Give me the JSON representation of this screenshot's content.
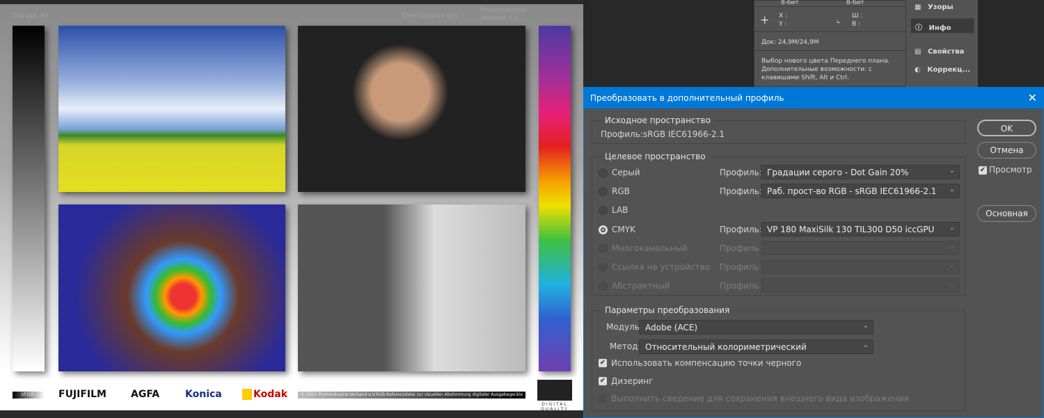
{
  "document": {
    "resolution_label": "300 ppi, A4",
    "initiative": "Eine Initiative des",
    "org_line1": "Photoindustrie-",
    "org_line2": "Verband e.V.",
    "srgb_badge": "sRGB",
    "logos": [
      "FUJIFILM",
      "AGFA",
      "Konica",
      "Kodak"
    ],
    "copyright": "© 2001 Photoindustrie-Verband e.V.",
    "ref_caption": "RGB-Referenzdatei zur visuellen Abstimmung digitaler Ausgabegeräte",
    "dq_logo": "DIGITAL QUALITY"
  },
  "info_panel": {
    "bit_left": "8-бит",
    "bit_right": "8-бит",
    "x_label": "X :",
    "y_label": "Y :",
    "w_label": "Ш :",
    "h_label": "В :",
    "doc": "Док: 24,9M/24,9M",
    "hint": "Выбор нового цвета Переднего плана. Дополнительные возможности: с клавишами Shift, Alt и Ctrl."
  },
  "side_panels": [
    {
      "label": "Узоры",
      "icon": "patterns-icon"
    },
    {
      "label": "Инфо",
      "icon": "info-icon",
      "active": true
    },
    {
      "label": "Свойства",
      "icon": "properties-icon"
    },
    {
      "label": "Коррекц...",
      "icon": "adjustments-icon"
    }
  ],
  "dialog": {
    "title": "Преобразовать в дополнительный профиль",
    "source": {
      "legend": "Исходное пространство",
      "profile_label": "Профиль:",
      "profile": "sRGB IEC61966-2.1"
    },
    "target": {
      "legend": "Целевое пространство",
      "profile_label": "Профиль:",
      "options": [
        {
          "label": "Серый",
          "value": "Градации серого - Dot Gain 20%",
          "enabled": true,
          "selected": false
        },
        {
          "label": "RGB",
          "value": "Раб. прост-во RGB - sRGB IEC61966-2.1",
          "enabled": true,
          "selected": false
        },
        {
          "label": "LAB",
          "enabled": true,
          "selected": false
        },
        {
          "label": "CMYK",
          "value": "VP 180 MaxiSilk 130 TIL300 D50 iccGPU",
          "enabled": true,
          "selected": true
        },
        {
          "label": "Многоканальный",
          "value": "",
          "enabled": false
        },
        {
          "label": "Ссылка на устройство",
          "value": "",
          "enabled": false
        },
        {
          "label": "Абстрактный",
          "value": "",
          "enabled": false
        }
      ]
    },
    "conversion": {
      "legend": "Параметры преобразования",
      "module_label": "Модуль:",
      "module": "Adobe (ACE)",
      "method_label": "Метод:",
      "method": "Относительный колориметрический",
      "black_point": "Использовать компенсацию точки черного",
      "black_point_checked": true,
      "dither": "Дизеринг",
      "dither_checked": true,
      "flatten": "Выполнить сведение для сохранения внешнего вида изображения",
      "flatten_checked": false
    },
    "ok": "OK",
    "cancel": "Отмена",
    "preview": "Просмотр",
    "preview_checked": true,
    "advanced": "Основная",
    "accent": "#0078d7"
  }
}
